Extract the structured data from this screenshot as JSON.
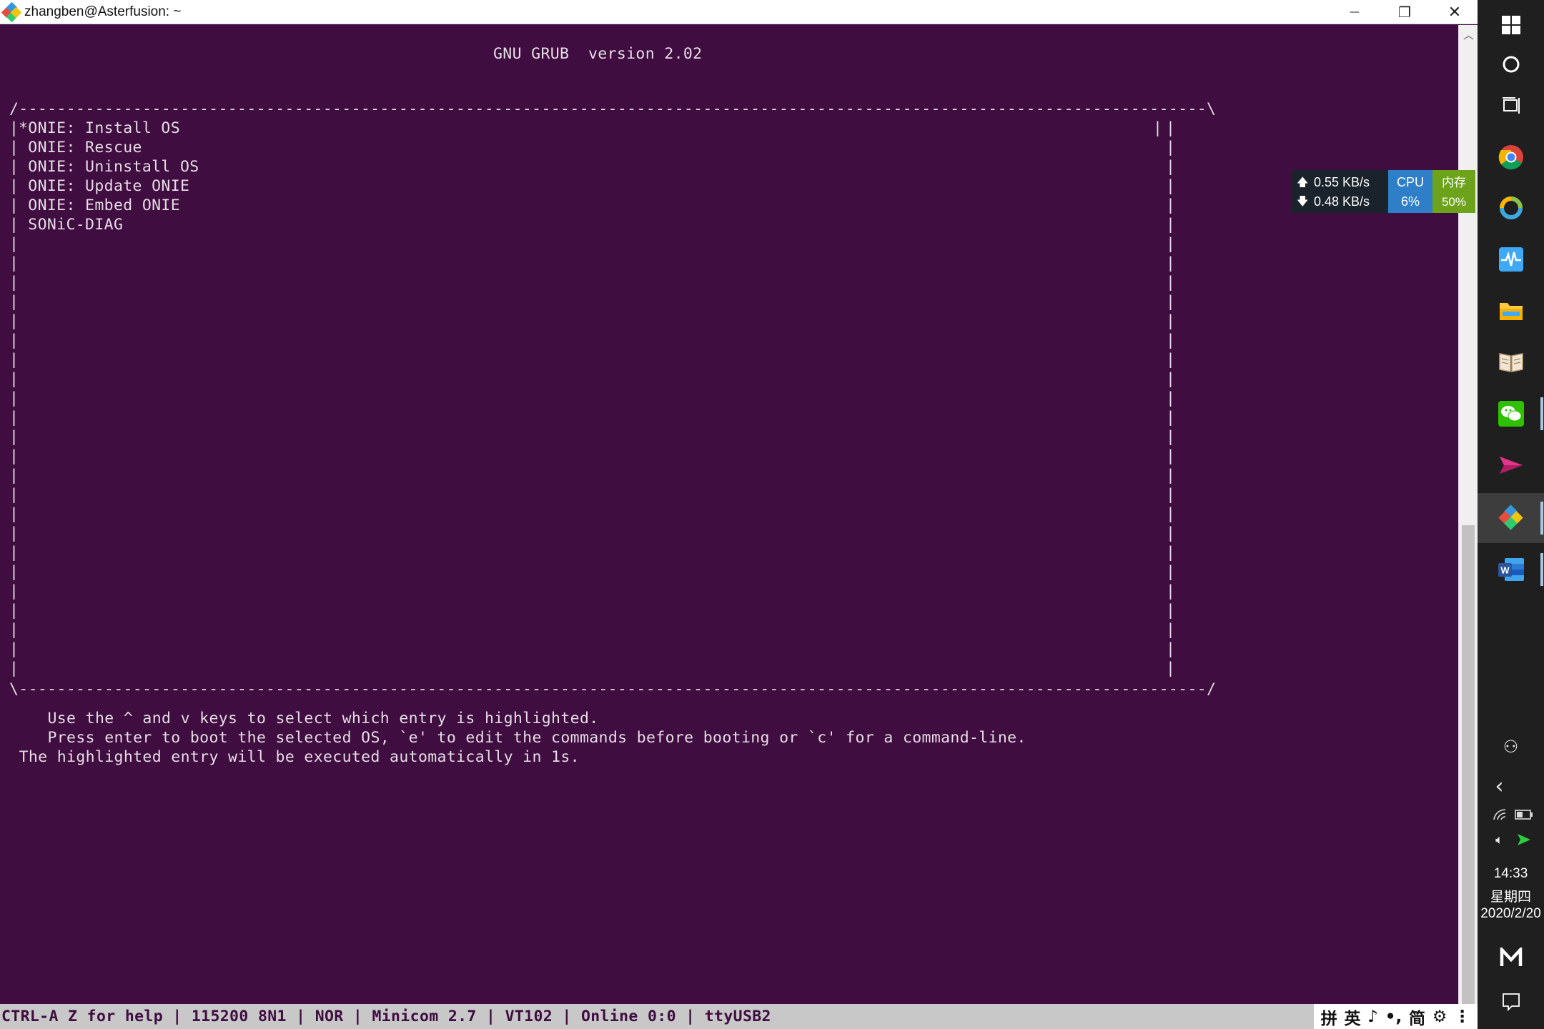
{
  "window": {
    "title": "zhangben@Asterfusion: ~",
    "minimize_glyph": "—",
    "restore_glyph": "❐",
    "close_glyph": "✕"
  },
  "grub": {
    "header": "GNU GRUB  version 2.02",
    "box_top": "/-----------------------------------------------------------------------------------------------------------------------------\\",
    "box_bottom": "\\-----------------------------------------------------------------------------------------------------------------------------/",
    "menu_entries": [
      "*ONIE: Install OS",
      " ONIE: Rescue",
      " ONIE: Uninstall OS",
      " ONIE: Update ONIE",
      " ONIE: Embed ONIE",
      " SONiC-DIAG"
    ],
    "selected_index": 0,
    "help_lines": [
      "     Use the ^ and v keys to select which entry is highlighted.",
      "     Press enter to boot the selected OS, `e' to edit the commands before booting or `c' for a command-line.",
      "  The highlighted entry will be executed automatically in 1s."
    ]
  },
  "statusbar": {
    "text": "CTRL-A Z for help | 115200 8N1 | NOR | Minicom 2.7 | VT102 | Online 0:0 | ttyUSB2"
  },
  "ime": {
    "items": [
      "拼",
      "英",
      "♪",
      "•,",
      "简",
      "⚙",
      "⋮"
    ]
  },
  "netmon": {
    "up_arrow": "🡅",
    "down_arrow": "🡇",
    "upload": "0.55 KB/s",
    "download": "0.48 KB/s",
    "cpu_label": "CPU",
    "cpu_value": "6%",
    "mem_label": "内存",
    "mem_value": "50%"
  },
  "taskbar": {
    "tray": {
      "people_glyph": "⚇",
      "chevron_glyph": "‹",
      "wifi_glyph": "◠",
      "speaker_glyph": "🔈︎"
    },
    "time": "14:33",
    "weekday": "星期四",
    "date": "2020/2/20",
    "colors": {
      "chrome": "#4285f4",
      "wechat": "#2dc100",
      "word": "#2b579a",
      "folder": "#ffc83d"
    }
  }
}
